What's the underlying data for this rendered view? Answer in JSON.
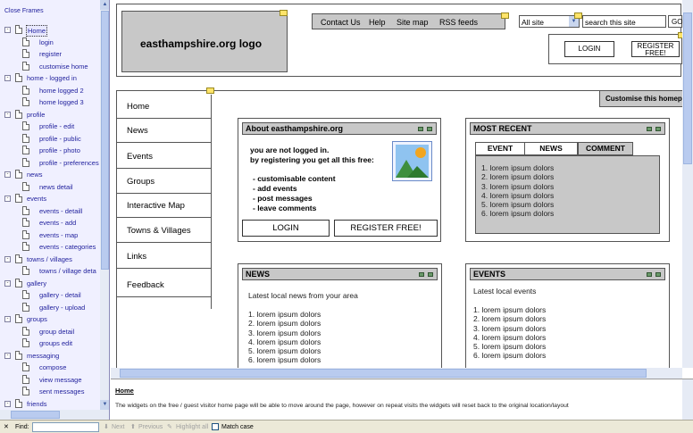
{
  "left_frame": {
    "close_frames": "Close Frames",
    "tree": [
      {
        "label": "Home",
        "level": 0,
        "expander": "-",
        "selected": true
      },
      {
        "label": "login",
        "level": 1
      },
      {
        "label": "register",
        "level": 1
      },
      {
        "label": "customise home",
        "level": 1
      },
      {
        "label": "home - logged in",
        "level": 0,
        "expander": "-"
      },
      {
        "label": "home logged 2",
        "level": 1
      },
      {
        "label": "home logged 3",
        "level": 1
      },
      {
        "label": "profile",
        "level": 0,
        "expander": "-"
      },
      {
        "label": "profile - edit",
        "level": 1
      },
      {
        "label": "profile - public",
        "level": 1
      },
      {
        "label": "profile - photo",
        "level": 1
      },
      {
        "label": "profile - preferences",
        "level": 1
      },
      {
        "label": "news",
        "level": 0,
        "expander": "-"
      },
      {
        "label": "news detail",
        "level": 1
      },
      {
        "label": "events",
        "level": 0,
        "expander": "-"
      },
      {
        "label": "events - detaill",
        "level": 1
      },
      {
        "label": "events - add",
        "level": 1
      },
      {
        "label": "events - map",
        "level": 1
      },
      {
        "label": "events - categories",
        "level": 1
      },
      {
        "label": "towns / villages",
        "level": 0,
        "expander": "-"
      },
      {
        "label": "towns / village deta",
        "level": 1
      },
      {
        "label": "gallery",
        "level": 0,
        "expander": "-"
      },
      {
        "label": "gallery - detail",
        "level": 1
      },
      {
        "label": "gallery - upload",
        "level": 1
      },
      {
        "label": "groups",
        "level": 0,
        "expander": "-"
      },
      {
        "label": "group detail",
        "level": 1
      },
      {
        "label": "groups edit",
        "level": 1
      },
      {
        "label": "messaging",
        "level": 0,
        "expander": "-"
      },
      {
        "label": "compose",
        "level": 1
      },
      {
        "label": "view message",
        "level": 1
      },
      {
        "label": "sent messages",
        "level": 1
      },
      {
        "label": "friends",
        "level": 0,
        "expander": "-"
      }
    ]
  },
  "header": {
    "logo": "easthampshire.org logo",
    "links": [
      "Contact Us",
      "Help",
      "Site map",
      "RSS feeds"
    ],
    "site_select": "All site",
    "search_placeholder": "search this site",
    "go": "GO",
    "login": "LOGIN",
    "register": "REGISTER FREE!"
  },
  "customise_tab": "Customise this homepage",
  "nav": [
    "Home",
    "News",
    "Events",
    "Groups",
    "Interactive Map",
    "Towns & Villages",
    "Links",
    "Feedback"
  ],
  "about": {
    "title": "About easthampshire.org",
    "intro_1": "you are not logged in.",
    "intro_2": "by registering you get all this free:",
    "bullets": [
      "- customisable content",
      "- add events",
      "- post messages",
      "- leave comments"
    ],
    "login": "LOGIN",
    "register": "REGISTER FREE!"
  },
  "most_recent": {
    "title": "MOST RECENT",
    "tabs": [
      "EVENT",
      "NEWS",
      "COMMENT"
    ],
    "items": [
      "1. lorem ipsum dolors",
      "2. lorem ipsum dolors",
      "3. lorem ipsum dolors",
      "4. lorem ipsum dolors",
      "5. lorem ipsum dolors",
      "6. lorem ipsum dolors"
    ]
  },
  "news": {
    "title": "NEWS",
    "subtitle": "Latest local news from your area",
    "items": [
      "1. lorem ipsum dolors",
      "2. lorem ipsum dolors",
      "3. lorem ipsum dolors",
      "4. lorem ipsum dolors",
      "5. lorem ipsum dolors",
      "6. lorem ipsum dolors"
    ]
  },
  "events": {
    "title": "EVENTS",
    "subtitle": "Latest local events",
    "items": [
      "1. lorem ipsum dolors",
      "2. lorem ipsum dolors",
      "3. lorem ipsum dolors",
      "4. lorem ipsum dolors",
      "5. lorem ipsum dolors",
      "6. lorem ipsum dolors"
    ]
  },
  "notes": {
    "title": "Home",
    "text": "The widgets on the free / guest visitor home page will be able to move around the page, however on repeat visits the widgets will reset back to the original location/layout"
  },
  "findbar": {
    "find_label": "Find:",
    "next": "Next",
    "previous": "Previous",
    "highlight": "Highlight all",
    "match_case": "Match case"
  }
}
